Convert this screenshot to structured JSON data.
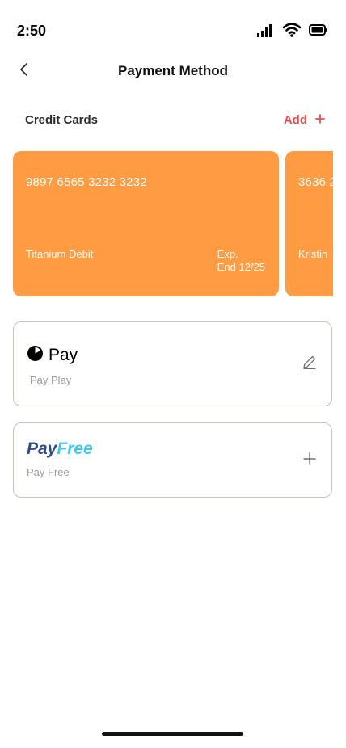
{
  "status": {
    "time": "2:50"
  },
  "nav": {
    "title": "Payment Method"
  },
  "credit_cards": {
    "title": "Credit Cards",
    "add_label": "Add",
    "cards": [
      {
        "number": "9897 6565 3232 3232",
        "name": "Titanium Debit",
        "exp_label": "Exp.",
        "exp_value": "End 12/25"
      },
      {
        "number": "3636 2",
        "name": "Kristin"
      }
    ]
  },
  "methods": [
    {
      "logo_text": "Pay",
      "subtitle": "Pay Play",
      "action": "edit-icon"
    },
    {
      "logo_text_1": "Pay",
      "logo_text_2": "Free",
      "subtitle": "Pay Free",
      "action": "plus-icon"
    }
  ],
  "colors": {
    "card": "#ff9b42",
    "accent": "#ef4a4f",
    "payfree_dark": "#2f4b8f",
    "payfree_light": "#3fc7f0",
    "border": "#c8c4b4"
  }
}
